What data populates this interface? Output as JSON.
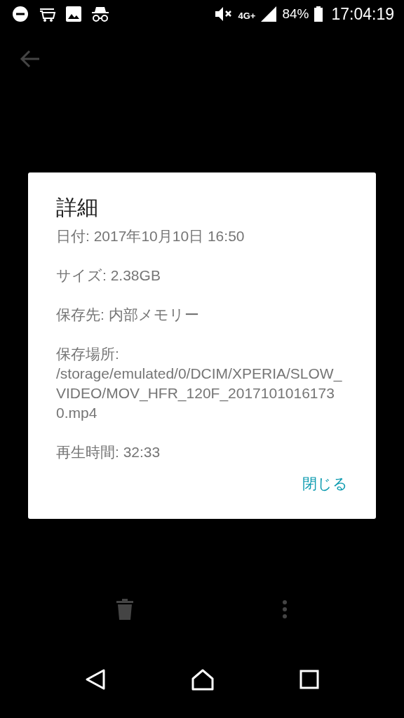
{
  "status_bar": {
    "network": "4G+",
    "battery": "84%",
    "time": "17:04:19"
  },
  "dialog": {
    "title": "詳細",
    "details": [
      "日付: 2017年10月10日 16:50",
      "サイズ: 2.38GB",
      "保存先: 内部メモリー",
      "保存場所: /storage/emulated/0/DCIM/XPERIA/SLOW_VIDEO/MOV_HFR_120F_20171010161730.mp4",
      "再生時間: 32:33"
    ],
    "button": "閉じる"
  }
}
